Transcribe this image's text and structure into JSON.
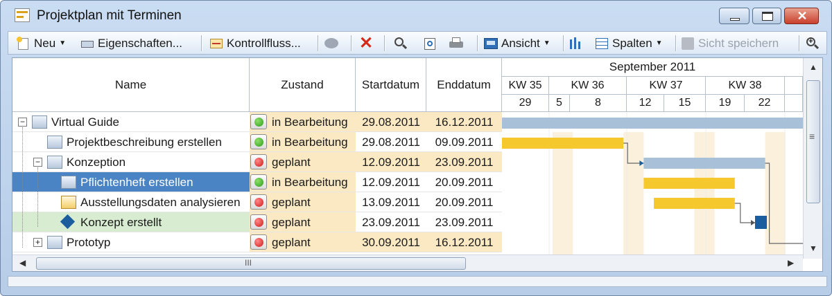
{
  "window": {
    "title": "Projektplan mit Terminen"
  },
  "toolbar": {
    "new_label": "Neu",
    "properties_label": "Eigenschaften...",
    "controlflow_label": "Kontrollfluss...",
    "view_label": "Ansicht",
    "columns_label": "Spalten",
    "save_view_label": "Sicht speichern"
  },
  "columns": {
    "name": "Name",
    "state": "Zustand",
    "start": "Startdatum",
    "end": "Enddatum"
  },
  "timeline": {
    "month": "September 2011",
    "weeks": [
      "KW 35",
      "KW 36",
      "KW 37",
      "KW 38"
    ],
    "days": [
      "29",
      "5",
      "8",
      "12",
      "15",
      "19",
      "22"
    ]
  },
  "tasks": [
    {
      "name": "Virtual Guide",
      "state": "in Bearbeitung",
      "status": "green",
      "start": "29.08.2011",
      "end": "16.12.2011"
    },
    {
      "name": "Projektbeschreibung erstellen",
      "state": "in Bearbeitung",
      "status": "green",
      "start": "29.08.2011",
      "end": "09.09.2011"
    },
    {
      "name": "Konzeption",
      "state": "geplant",
      "status": "red",
      "start": "12.09.2011",
      "end": "23.09.2011"
    },
    {
      "name": "Pflichtenheft erstellen",
      "state": "in Bearbeitung",
      "status": "green",
      "start": "12.09.2011",
      "end": "20.09.2011"
    },
    {
      "name": "Ausstellungsdaten analysieren",
      "state": "geplant",
      "status": "red",
      "start": "13.09.2011",
      "end": "20.09.2011"
    },
    {
      "name": "Konzept erstellt",
      "state": "geplant",
      "status": "red",
      "start": "23.09.2011",
      "end": "23.09.2011"
    },
    {
      "name": "Prototyp",
      "state": "geplant",
      "status": "red",
      "start": "30.09.2011",
      "end": "16.12.2011"
    }
  ],
  "scrollbar": {
    "h_grip": "III",
    "v_grip": "≡"
  },
  "colors": {
    "selection": "#4a84c4",
    "milestone_row": "#d7ecd0",
    "summary_bar": "#a8c1d9",
    "task_bar": "#f5c92e",
    "milestone": "#1c5e9d"
  }
}
